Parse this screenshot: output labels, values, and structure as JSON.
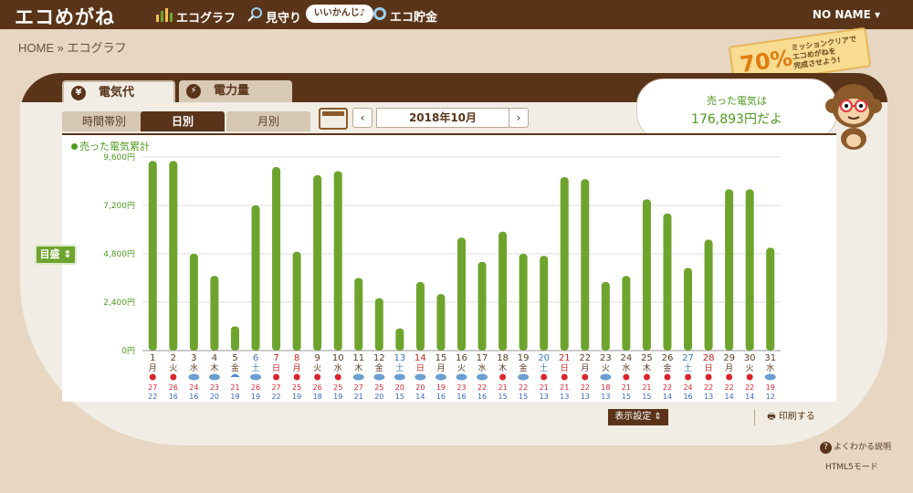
{
  "header": {
    "logo": "エコめがね",
    "nav": [
      {
        "label": "エコグラフ",
        "icon": "bar-chart-icon"
      },
      {
        "label": "見守り",
        "icon": "magnifier-icon"
      },
      {
        "label": "エコ貯金",
        "icon": "coin-icon"
      }
    ],
    "pill": "いいかんじ♪",
    "user": "NO NAME ▾"
  },
  "breadcrumb": "HOME » エコグラフ",
  "mission": {
    "pct": "70%",
    "line1": "ミッションクリアで",
    "line2": "エコめがねを",
    "line3": "完成させよう!"
  },
  "tabs": {
    "money": "電気代",
    "power": "電力量"
  },
  "subtabs": [
    "時間帯別",
    "日別",
    "月別"
  ],
  "month_label": "2018年10月",
  "balloon": {
    "line1": "売った電気は",
    "line2": "176,893円だよ"
  },
  "legend": "売った電気累計",
  "scale_button": "目盛 ⇕",
  "display_button": "表示設定 ⇕",
  "print_button": "印刷する",
  "help": "よくわかる説明",
  "html5": "HTML5モード",
  "colors": {
    "bar": "#6ea42d",
    "brown": "#5a3419",
    "saturday": "#3a78c2",
    "sunday": "#c8231c"
  },
  "chart_data": {
    "type": "bar",
    "ylim": [
      0,
      9600
    ],
    "yticks": [
      "0円",
      "2,400円",
      "4,800円",
      "7,200円",
      "9,600円"
    ],
    "ytick_values": [
      0,
      2400,
      4800,
      7200,
      9600
    ],
    "categories": [
      "1",
      "2",
      "3",
      "4",
      "5",
      "6",
      "7",
      "8",
      "9",
      "10",
      "11",
      "12",
      "13",
      "14",
      "15",
      "16",
      "17",
      "18",
      "19",
      "20",
      "21",
      "22",
      "23",
      "24",
      "25",
      "26",
      "27",
      "28",
      "29",
      "30",
      "31"
    ],
    "weekdays": [
      "月",
      "火",
      "水",
      "木",
      "金",
      "土",
      "日",
      "月",
      "火",
      "水",
      "木",
      "金",
      "土",
      "日",
      "月",
      "火",
      "水",
      "木",
      "金",
      "土",
      "日",
      "月",
      "火",
      "水",
      "木",
      "金",
      "土",
      "日",
      "月",
      "火",
      "水"
    ],
    "weekday_types": [
      "w",
      "w",
      "w",
      "w",
      "w",
      "sat",
      "sun",
      "hol",
      "w",
      "w",
      "w",
      "w",
      "sat",
      "sun",
      "w",
      "w",
      "w",
      "w",
      "w",
      "sat",
      "sun",
      "w",
      "w",
      "w",
      "w",
      "w",
      "sat",
      "sun",
      "w",
      "w",
      "w"
    ],
    "values": [
      9400,
      9400,
      4800,
      3700,
      1200,
      7200,
      9100,
      4900,
      8700,
      8900,
      3600,
      2600,
      1100,
      3400,
      2800,
      5600,
      4400,
      5900,
      4800,
      4700,
      8600,
      8500,
      3400,
      3700,
      7500,
      6800,
      4100,
      5500,
      8000,
      8000,
      5100
    ],
    "weather": [
      "sun",
      "sun",
      "cloud",
      "cloud",
      "umbrella",
      "cloud",
      "sun",
      "sun",
      "sun",
      "sun",
      "cloud",
      "cloud",
      "cloud",
      "cloud",
      "cloud",
      "cloud",
      "cloud",
      "sun",
      "cloud",
      "sun",
      "sun",
      "sun",
      "cloud",
      "sun",
      "sun",
      "sun",
      "sun",
      "sun",
      "sun",
      "sun",
      "cloud"
    ],
    "temp_high": [
      "27",
      "26",
      "24",
      "23",
      "21",
      "26",
      "27",
      "25",
      "26",
      "25",
      "27",
      "25",
      "20",
      "20",
      "19",
      "23",
      "22",
      "21",
      "22",
      "21",
      "21",
      "22",
      "18",
      "21",
      "21",
      "22",
      "24",
      "22",
      "22",
      "22",
      "19"
    ],
    "temp_low": [
      "22",
      "16",
      "16",
      "20",
      "19",
      "19",
      "22",
      "19",
      "18",
      "19",
      "21",
      "20",
      "15",
      "14",
      "16",
      "16",
      "16",
      "15",
      "15",
      "13",
      "13",
      "13",
      "13",
      "15",
      "15",
      "14",
      "16",
      "13",
      "14",
      "14",
      "12"
    ],
    "series": [
      {
        "name": "売った電気累計",
        "values": [
          9400,
          9400,
          4800,
          3700,
          1200,
          7200,
          9100,
          4900,
          8700,
          8900,
          3600,
          2600,
          1100,
          3400,
          2800,
          5600,
          4400,
          5900,
          4800,
          4700,
          8600,
          8500,
          3400,
          3700,
          7500,
          6800,
          4100,
          5500,
          8000,
          8000,
          5100
        ]
      }
    ],
    "grid": true
  }
}
